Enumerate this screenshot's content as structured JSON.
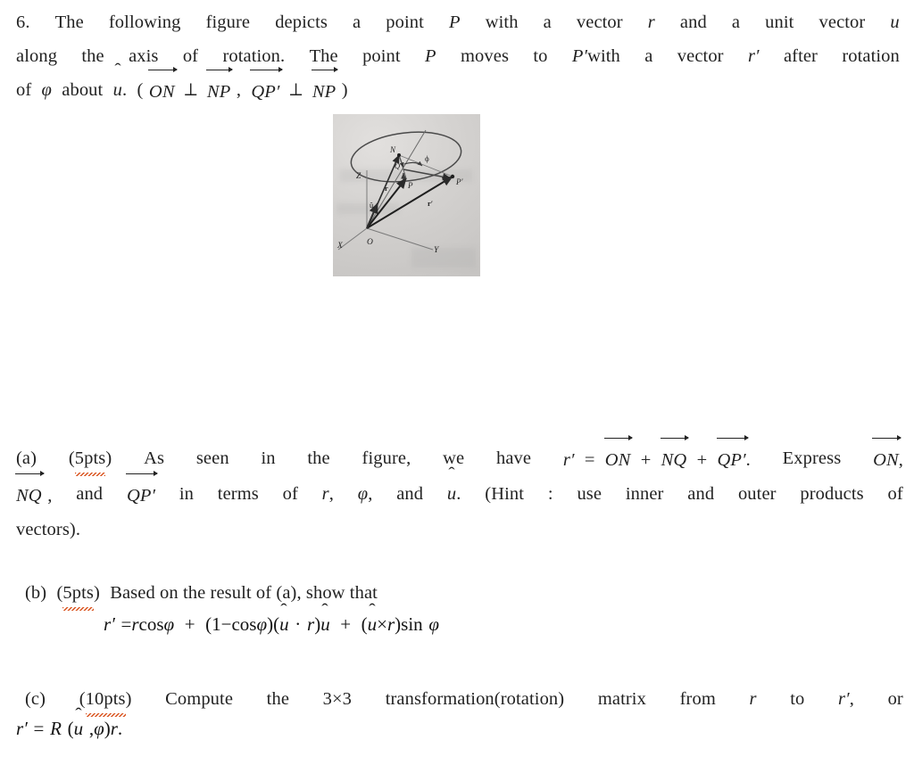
{
  "document": {
    "type": "homework-problem",
    "problem_number": "6.",
    "background_color": "#ffffff",
    "text_color": "#222222",
    "spellcheck_underline_color": "#d9531e"
  },
  "problem_statement": {
    "line1": {
      "words": [
        "6.",
        "The",
        "following",
        "figure",
        "depicts",
        "a",
        "point",
        "P",
        "with",
        "a",
        "vector",
        "r",
        "and",
        "a",
        "unit",
        "vector",
        "u-hat"
      ],
      "plain": "6. The following figure depicts a point P with a vector r and a unit vector û"
    },
    "line2": {
      "words": [
        "along",
        "the",
        "axis",
        "of",
        "rotation.",
        "The",
        "point",
        "P",
        "moves",
        "to",
        "P'with",
        "a",
        "vector",
        "r'",
        "after",
        "rotation"
      ],
      "plain": "along the axis of rotation. The point P moves to P'with a vector r′ after rotation"
    },
    "line3": {
      "plain": "of φ about û. (ON⃗ ⟂ NP⃗ , QP′⃗ ⟂ NP⃗ )",
      "tokens": {
        "of": "of",
        "phi": "φ",
        "about": "about",
        "uhat": "u",
        "period": ".",
        "open_paren": "(",
        "vec_ON": "ON",
        "perp1": "⟂",
        "vec_NP_1": "NP",
        "comma": ",",
        "vec_QP": "QP",
        "prime": "′",
        "perp2": "⟂",
        "vec_NP_2": "NP",
        "close_paren": ")"
      }
    }
  },
  "figure": {
    "caption": "",
    "kind": "scanned-photo-diagram",
    "description": "Rotation of point P about unit axis u-hat through angle phi producing P-prime; circle of rotation drawn as an ellipse with center N.",
    "labels": {
      "N": "N",
      "Q": "Q",
      "P": "P",
      "P_prime": "P'",
      "phi": "ϕ",
      "r": "r",
      "r_prime": "r'",
      "u_hat": "û",
      "O": "O",
      "X": "X",
      "Y": "Y",
      "Z": "Z"
    },
    "background_color": "#d4d2d0",
    "ink_color": "#3a3a3a"
  },
  "part_a": {
    "line1": {
      "label": "(a)",
      "points": "(5pts)",
      "points_misspelled_token": "5pts",
      "text_before_eq": "As seen in the figure, we have",
      "equation_plain": "r′ = ON⃗ + NQ⃗ + QP′⃗ .",
      "tokens": {
        "r": "r",
        "prime": "′",
        "equals": "=",
        "vec_ON": "ON",
        "plus1": "+",
        "vec_NQ": "NQ",
        "plus2": "+",
        "vec_QP": "QP",
        "qp_prime": "′",
        "period": ".",
        "express": "Express",
        "vec_ON_2": "ON",
        "comma": ","
      }
    },
    "line2": {
      "plain": "NQ⃗ , and QP′⃗ in terms of r, φ, and û. (Hint : use inner and outer products of",
      "tokens": {
        "vec_NQ": "NQ",
        "comma1": ",",
        "and1": "and",
        "vec_QP": "QP",
        "qp_prime": "′",
        "in_terms_of": "in terms of",
        "r": "r",
        "comma2": ",",
        "phi": "φ",
        "comma3": ",",
        "and2": "and",
        "uhat": "u",
        "period": ".",
        "hint_open": "(Hint",
        "colon": ":",
        "hint_rest": "use inner and outer products of"
      }
    },
    "line3": {
      "plain": "vectors)."
    }
  },
  "part_b": {
    "line1": {
      "label": "(b)",
      "points": "(5pts)",
      "points_misspelled_token": "5pts",
      "text": "Based on the result of (a), show that"
    },
    "equation": {
      "plain": "r′ = r cos φ + (1 − cos φ)(û · r)û + (û×r) sin φ",
      "tokens": {
        "r": "r",
        "prime": "′",
        "equals": "=",
        "r2": "r",
        "cos1": "cos",
        "phi1": "φ",
        "plus1": "+",
        "open1": "(",
        "one": "1",
        "minus": "−",
        "cos2": "cos",
        "phi2": "φ",
        "close1": ")",
        "open2": "(",
        "uhat1": "u",
        "dot": "·",
        "r3": "r",
        "close2": ")",
        "uhat2": "u",
        "plus2": "+",
        "open3": "(",
        "uhat3": "u",
        "cross": "×",
        "r4": "r",
        "close3": ")",
        "sin": "sin",
        "phi3": "φ"
      }
    }
  },
  "part_c": {
    "line1": {
      "label": "(c)",
      "points": "(10pts)",
      "points_misspelled_token": "10pts",
      "plain": "Compute the 3×3 transformation(rotation) matrix from r to r′, or",
      "tokens": {
        "compute": "Compute",
        "the": "the",
        "three_by_three": "3×3",
        "transformation": "transformation(rotation)",
        "matrix": "matrix",
        "from": "from",
        "r": "r",
        "to": "to",
        "r_prime": "r",
        "prime": "′",
        "comma": ",",
        "or": "or"
      }
    },
    "equation": {
      "plain": "r′ = R (û , φ) r.",
      "tokens": {
        "r": "r",
        "prime": "′",
        "equals": "=",
        "R": "R",
        "open": "(",
        "uhat": "u",
        "comma": ",",
        "phi": "φ",
        "close": ")",
        "r2": "r",
        "period": "."
      }
    }
  }
}
